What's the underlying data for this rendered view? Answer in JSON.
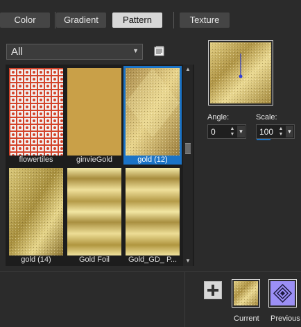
{
  "tabs": [
    {
      "label": "Color",
      "active": false
    },
    {
      "label": "Gradient",
      "active": false
    },
    {
      "label": "Pattern",
      "active": true
    },
    {
      "label": "Texture",
      "active": false
    }
  ],
  "category": {
    "selected": "All"
  },
  "patterns": [
    {
      "name": "flowertiles",
      "selected": false
    },
    {
      "name": "ginvieGold",
      "selected": false
    },
    {
      "name": "gold (12)",
      "selected": true
    },
    {
      "name": "gold (14)",
      "selected": false
    },
    {
      "name": "Gold Foil",
      "selected": false
    },
    {
      "name": "Gold_GD_ P..."
    }
  ],
  "controls": {
    "angle_label": "Angle:",
    "angle_value": "0",
    "scale_label": "Scale:",
    "scale_value": "100"
  },
  "swatches": {
    "current_label": "Current",
    "previous_label": "Previous"
  },
  "colors": {
    "accent": "#1b73c6",
    "gold": "#c9a84a",
    "tab_active": "#d7d7d7"
  }
}
